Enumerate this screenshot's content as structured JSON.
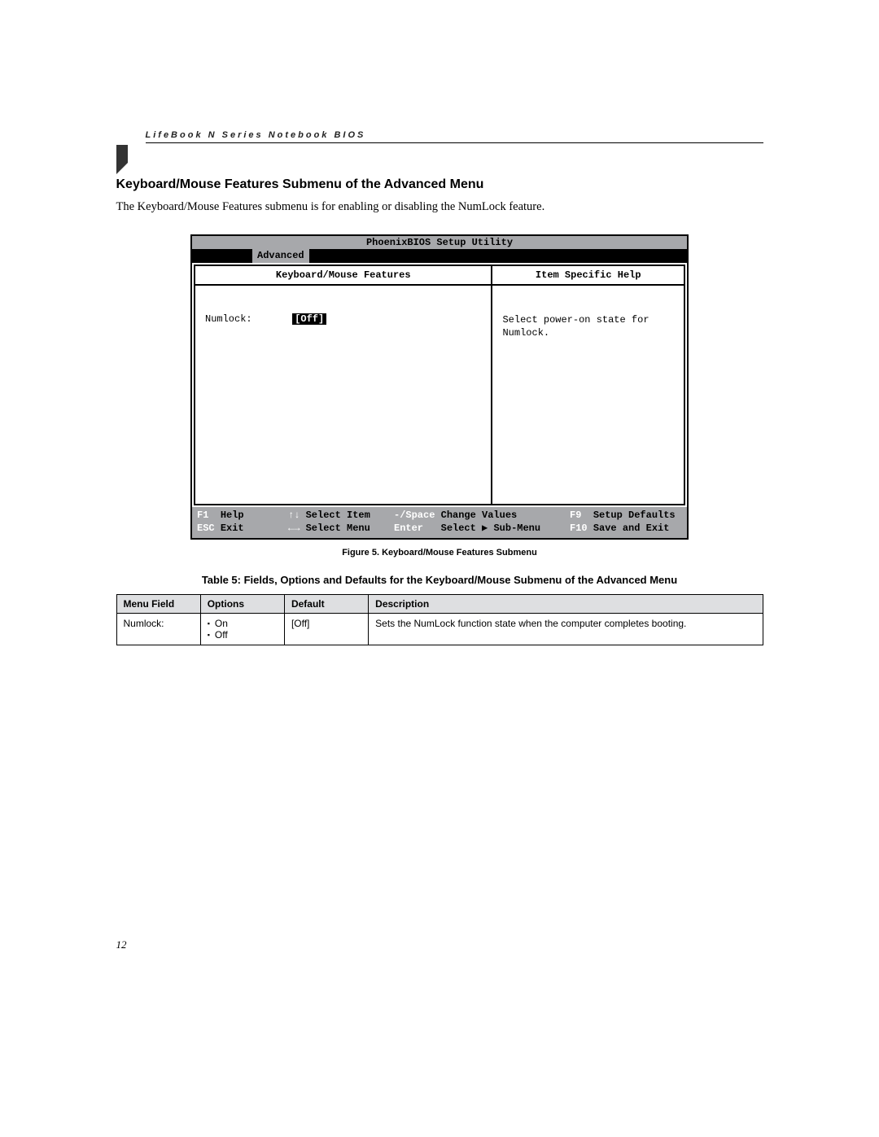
{
  "header": {
    "running": "LifeBook N Series Notebook BIOS"
  },
  "section": {
    "title": "Keyboard/Mouse Features Submenu of the Advanced Menu",
    "intro": "The Keyboard/Mouse Features submenu is for enabling or disabling the NumLock feature."
  },
  "bios": {
    "title": "PhoenixBIOS Setup Utility",
    "active_tab": "Advanced",
    "left_heading": "Keyboard/Mouse Features",
    "right_heading": "Item Specific Help",
    "field_label": "Numlock:",
    "field_value": "[Off]",
    "help_text": "Select power-on state for Numlock.",
    "footer": {
      "r1": {
        "k1": "F1",
        "l1": "Help",
        "k2": "↑↓",
        "l2": "Select Item",
        "k3": "-/Space",
        "l3": "Change Values",
        "k4": "F9",
        "l4": "Setup Defaults"
      },
      "r2": {
        "k1": "ESC",
        "l1": "Exit",
        "k2": "←→",
        "l2": "Select Menu",
        "k3": "Enter",
        "l3": "Select ▶ Sub-Menu",
        "k4": "F10",
        "l4": "Save and Exit"
      }
    }
  },
  "figure_caption": "Figure 5.  Keyboard/Mouse Features Submenu",
  "table_caption": "Table 5: Fields, Options and Defaults for the Keyboard/Mouse Submenu of the Advanced Menu",
  "table": {
    "headers": {
      "h1": "Menu Field",
      "h2": "Options",
      "h3": "Default",
      "h4": "Description"
    },
    "row": {
      "field": "Numlock:",
      "opt1": "On",
      "opt2": "Off",
      "def": "[Off]",
      "desc": "Sets the NumLock function state when the computer completes booting."
    }
  },
  "page_number": "12"
}
